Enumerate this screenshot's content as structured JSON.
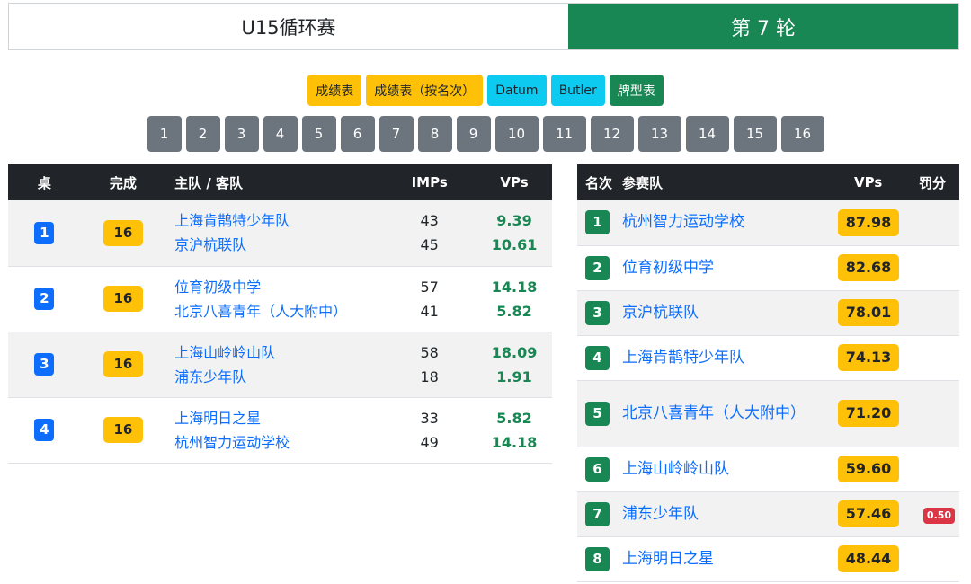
{
  "header": {
    "event_name": "U15循环赛",
    "round_label": "第 7 轮"
  },
  "reports": [
    {
      "label": "成绩表",
      "style": "warn"
    },
    {
      "label": "成绩表（按名次）",
      "style": "warn"
    },
    {
      "label": "Datum",
      "style": "info"
    },
    {
      "label": "Butler",
      "style": "info"
    },
    {
      "label": "牌型表",
      "style": "success"
    }
  ],
  "rounds": [
    "1",
    "2",
    "3",
    "4",
    "5",
    "6",
    "7",
    "8",
    "9",
    "10",
    "11",
    "12",
    "13",
    "14",
    "15",
    "16"
  ],
  "matches": {
    "headers": {
      "table": "桌",
      "done": "完成",
      "teams": "主队 / 客队",
      "imps": "IMPs",
      "vps": "VPs"
    },
    "rows": [
      {
        "table": "1",
        "done": "16",
        "home": "上海肯鹊特少年队",
        "away": "京沪杭联队",
        "home_imps": "43",
        "away_imps": "45",
        "home_vps": "9.39",
        "away_vps": "10.61"
      },
      {
        "table": "2",
        "done": "16",
        "home": "位育初级中学",
        "away": "北京八喜青年（人大附中）",
        "home_imps": "57",
        "away_imps": "41",
        "home_vps": "14.18",
        "away_vps": "5.82"
      },
      {
        "table": "3",
        "done": "16",
        "home": "上海山岭岭山队",
        "away": "浦东少年队",
        "home_imps": "58",
        "away_imps": "18",
        "home_vps": "18.09",
        "away_vps": "1.91"
      },
      {
        "table": "4",
        "done": "16",
        "home": "上海明日之星",
        "away": "杭州智力运动学校",
        "home_imps": "33",
        "away_imps": "49",
        "home_vps": "5.82",
        "away_vps": "14.18"
      }
    ]
  },
  "standings": {
    "headers": {
      "rank": "名次",
      "team": "参赛队",
      "vps": "VPs",
      "penalty": "罚分"
    },
    "rows": [
      {
        "rank": "1",
        "team": "杭州智力运动学校",
        "vps": "87.98",
        "penalty": ""
      },
      {
        "rank": "2",
        "team": "位育初级中学",
        "vps": "82.68",
        "penalty": ""
      },
      {
        "rank": "3",
        "team": "京沪杭联队",
        "vps": "78.01",
        "penalty": ""
      },
      {
        "rank": "4",
        "team": "上海肯鹊特少年队",
        "vps": "74.13",
        "penalty": ""
      },
      {
        "rank": "5",
        "team": "北京八喜青年（人大附中）",
        "vps": "71.20",
        "penalty": ""
      },
      {
        "rank": "6",
        "team": "上海山岭岭山队",
        "vps": "59.60",
        "penalty": ""
      },
      {
        "rank": "7",
        "team": "浦东少年队",
        "vps": "57.46",
        "penalty": "0.50"
      },
      {
        "rank": "8",
        "team": "上海明日之星",
        "vps": "48.44",
        "penalty": ""
      }
    ]
  },
  "colors": {
    "primary": "#0d6efd",
    "success": "#198754",
    "warning": "#ffc107",
    "info": "#0dcaf0",
    "danger": "#dc3545",
    "secondary": "#6c757d",
    "dark": "#212529"
  }
}
